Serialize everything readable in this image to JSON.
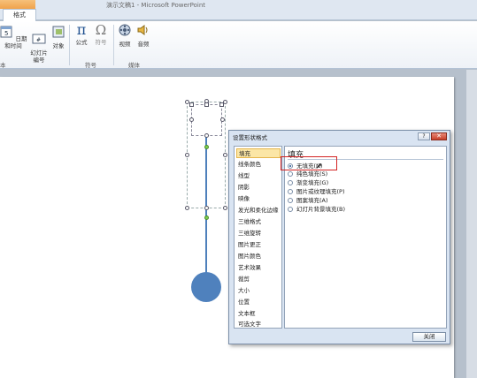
{
  "window": {
    "title": "演示文稿1 - Microsoft PowerPoint",
    "tab_format": "格式"
  },
  "ribbon": {
    "buttons": [
      {
        "label": "日期和时间",
        "icon": "calendar-icon"
      },
      {
        "label": "幻灯片\n编号",
        "icon": "slide-number-icon"
      },
      {
        "label": "对象",
        "icon": "object-icon"
      },
      {
        "label": "公式",
        "icon": "pi-icon"
      },
      {
        "label": "符号",
        "icon": "omega-icon"
      },
      {
        "label": "视频",
        "icon": "film-icon"
      },
      {
        "label": "音频",
        "icon": "speaker-icon"
      }
    ],
    "groups": {
      "text": "本",
      "symbols": "符号",
      "media": "媒体"
    }
  },
  "dialog": {
    "title": "设置形状格式",
    "help_label": "?",
    "close_label": "✕",
    "categories": [
      "填充",
      "线条颜色",
      "线型",
      "阴影",
      "映像",
      "发光和柔化边缘",
      "三维格式",
      "三维旋转",
      "图片更正",
      "图片颜色",
      "艺术效果",
      "裁剪",
      "大小",
      "位置",
      "文本框",
      "可选文字"
    ],
    "selected_category": "填充",
    "panel_title": "填充",
    "options": [
      {
        "label": "无填充(N)",
        "checked": true
      },
      {
        "label": "纯色填充(S)",
        "checked": false
      },
      {
        "label": "渐变填充(G)",
        "checked": false
      },
      {
        "label": "图片或纹理填充(P)",
        "checked": false
      },
      {
        "label": "图案填充(A)",
        "checked": false
      },
      {
        "label": "幻灯片背景填充(B)",
        "checked": false
      }
    ],
    "close_button": "关闭"
  },
  "colors": {
    "accent": "#4f81bd",
    "highlight": "#d32323"
  }
}
